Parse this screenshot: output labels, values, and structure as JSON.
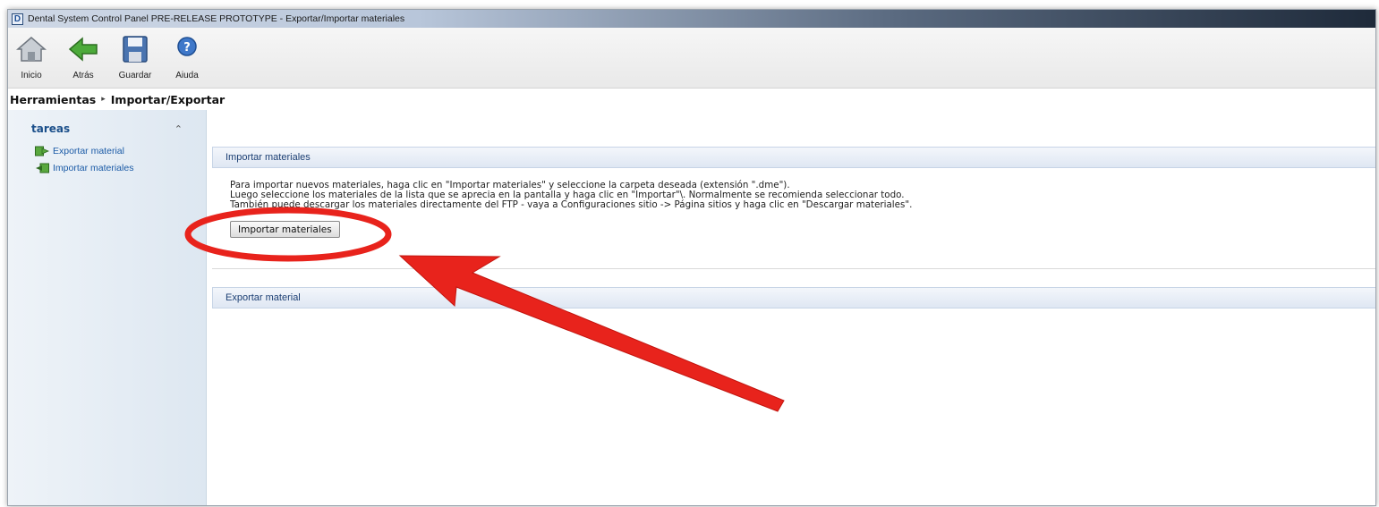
{
  "window": {
    "title": "Dental System Control Panel PRE-RELEASE PROTOTYPE  - Exportar/Importar materiales"
  },
  "toolbar": {
    "items": [
      {
        "label": "Inicio",
        "icon": "home-icon"
      },
      {
        "label": "Atrás",
        "icon": "back-arrow-icon"
      },
      {
        "label": "Guardar",
        "icon": "save-disk-icon"
      },
      {
        "label": "Aiuda",
        "icon": "help-icon"
      }
    ]
  },
  "breadcrumb": {
    "parent": "Herramientas",
    "separator": "▸",
    "current": "Importar/Exportar"
  },
  "sidebar": {
    "title": "tareas",
    "collapse_glyph": "⌃",
    "items": [
      {
        "label": "Exportar material",
        "icon": "export-icon"
      },
      {
        "label": "Importar materiales",
        "icon": "import-icon"
      }
    ]
  },
  "import_panel": {
    "title": "Importar materiales",
    "lines": [
      "Para importar nuevos materiales, haga clic en \"Importar materiales\" y seleccione la carpeta deseada (extensión \".dme\").",
      "Luego seleccione los materiales de la lista que se aprecia en la pantalla y haga clic en \"Importar\"\\. Normalmente se recomienda seleccionar todo.",
      "También puede descargar los materiales directamente del FTP - vaya a Configuraciones sitio -> Página sitios y haga clic en \"Descargar materiales\"."
    ],
    "button_label": "Importar materiales"
  },
  "export_panel": {
    "title": "Exportar material"
  },
  "annotation": {
    "color": "#e8231c"
  }
}
